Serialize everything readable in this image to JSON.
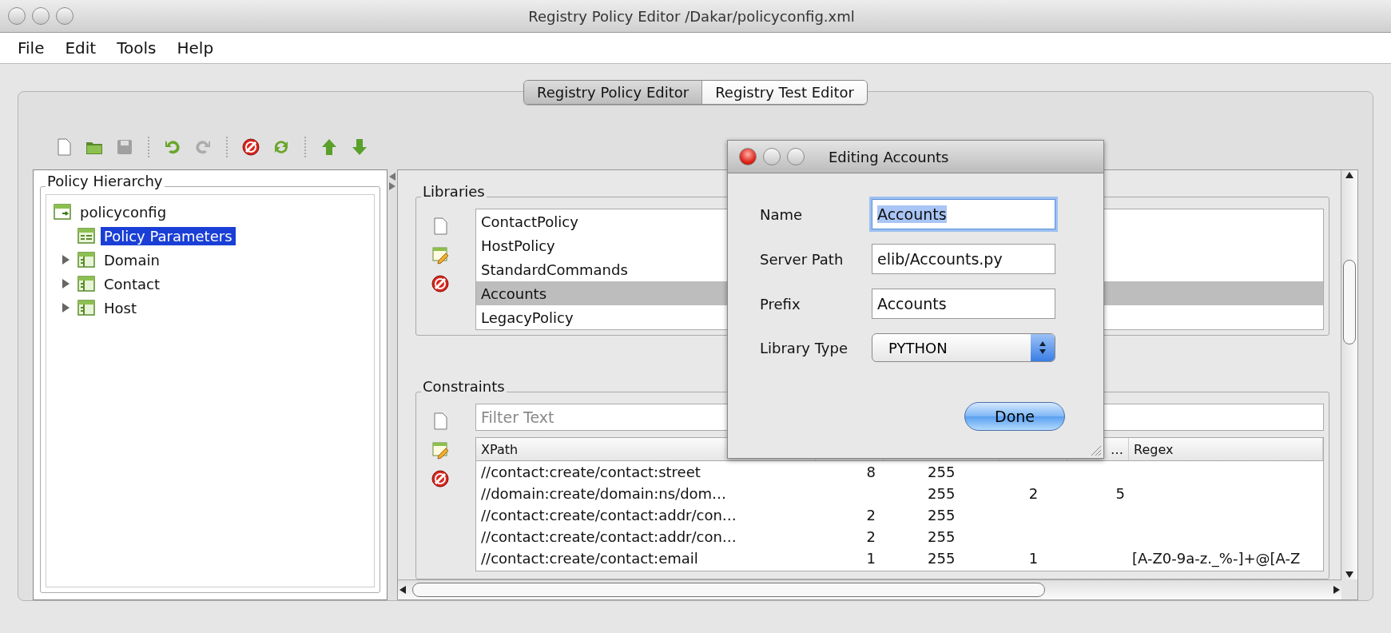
{
  "window": {
    "title": "Registry Policy Editor /Dakar/policyconfig.xml"
  },
  "menu": [
    "File",
    "Edit",
    "Tools",
    "Help"
  ],
  "tabs": [
    {
      "label": "Registry Policy Editor",
      "selected": true
    },
    {
      "label": "Registry Test Editor",
      "selected": false
    }
  ],
  "toolbar": [
    {
      "kind": "new",
      "disabled": false
    },
    {
      "kind": "open",
      "disabled": false
    },
    {
      "kind": "save",
      "disabled": true
    },
    {
      "kind": "separator"
    },
    {
      "kind": "undo",
      "disabled": false
    },
    {
      "kind": "redo",
      "disabled": true
    },
    {
      "kind": "separator"
    },
    {
      "kind": "delete",
      "disabled": false
    },
    {
      "kind": "refresh",
      "disabled": false
    },
    {
      "kind": "separator"
    },
    {
      "kind": "up",
      "disabled": false
    },
    {
      "kind": "down",
      "disabled": false
    }
  ],
  "hierarchy": {
    "title": "Policy Hierarchy",
    "tree": [
      {
        "label": "policyconfig",
        "kind": "root",
        "children": [
          {
            "label": "Policy Parameters",
            "kind": "parameters",
            "selected": true
          },
          {
            "label": "Domain",
            "kind": "group",
            "expanded": false,
            "selected": false
          },
          {
            "label": "Contact",
            "kind": "group",
            "expanded": false,
            "selected": false
          },
          {
            "label": "Host",
            "kind": "group",
            "expanded": false,
            "selected": false
          }
        ]
      }
    ]
  },
  "libraries": {
    "title": "Libraries",
    "actions": [
      {
        "kind": "new"
      },
      {
        "kind": "edit"
      },
      {
        "kind": "delete"
      }
    ],
    "items": [
      {
        "label": "ContactPolicy",
        "selected": false
      },
      {
        "label": "HostPolicy",
        "selected": false
      },
      {
        "label": "StandardCommands",
        "selected": false
      },
      {
        "label": "Accounts",
        "selected": true
      },
      {
        "label": "LegacyPolicy",
        "selected": false
      }
    ]
  },
  "constraints": {
    "title": "Constraints",
    "actions": [
      {
        "kind": "new"
      },
      {
        "kind": "edit"
      },
      {
        "kind": "delete"
      }
    ],
    "filter": {
      "placeholder": "Filter Text"
    },
    "table": {
      "header": {
        "column_1": "XPath",
        "column_5": "…",
        "column_6": "Regex"
      },
      "rows": [
        [
          "//contact:create/contact:street",
          "8",
          "255",
          null,
          null,
          null
        ],
        [
          "//domain:create/domain:ns/dom…",
          null,
          "255",
          "2",
          "5",
          null
        ],
        [
          "//contact:create/contact:addr/con…",
          "2",
          "255",
          null,
          null,
          null
        ],
        [
          "//contact:create/contact:addr/con…",
          "2",
          "255",
          null,
          null,
          null
        ],
        [
          "//contact:create/contact:email",
          "1",
          "255",
          "1",
          null,
          "[A-Z0-9a-z._%-]+@[A-Z"
        ]
      ]
    }
  },
  "dialog": {
    "title": "Editing Accounts",
    "fields": [
      {
        "label": "Name",
        "value": "Accounts",
        "kind": "text",
        "focused": true
      },
      {
        "label": "Server Path",
        "value": "elib/Accounts.py",
        "kind": "text",
        "focused": false
      },
      {
        "label": "Prefix",
        "value": "Accounts",
        "kind": "text",
        "focused": false
      },
      {
        "label": "Library Type",
        "value": "PYTHON",
        "kind": "select",
        "focused": false
      }
    ],
    "button": "Done"
  }
}
